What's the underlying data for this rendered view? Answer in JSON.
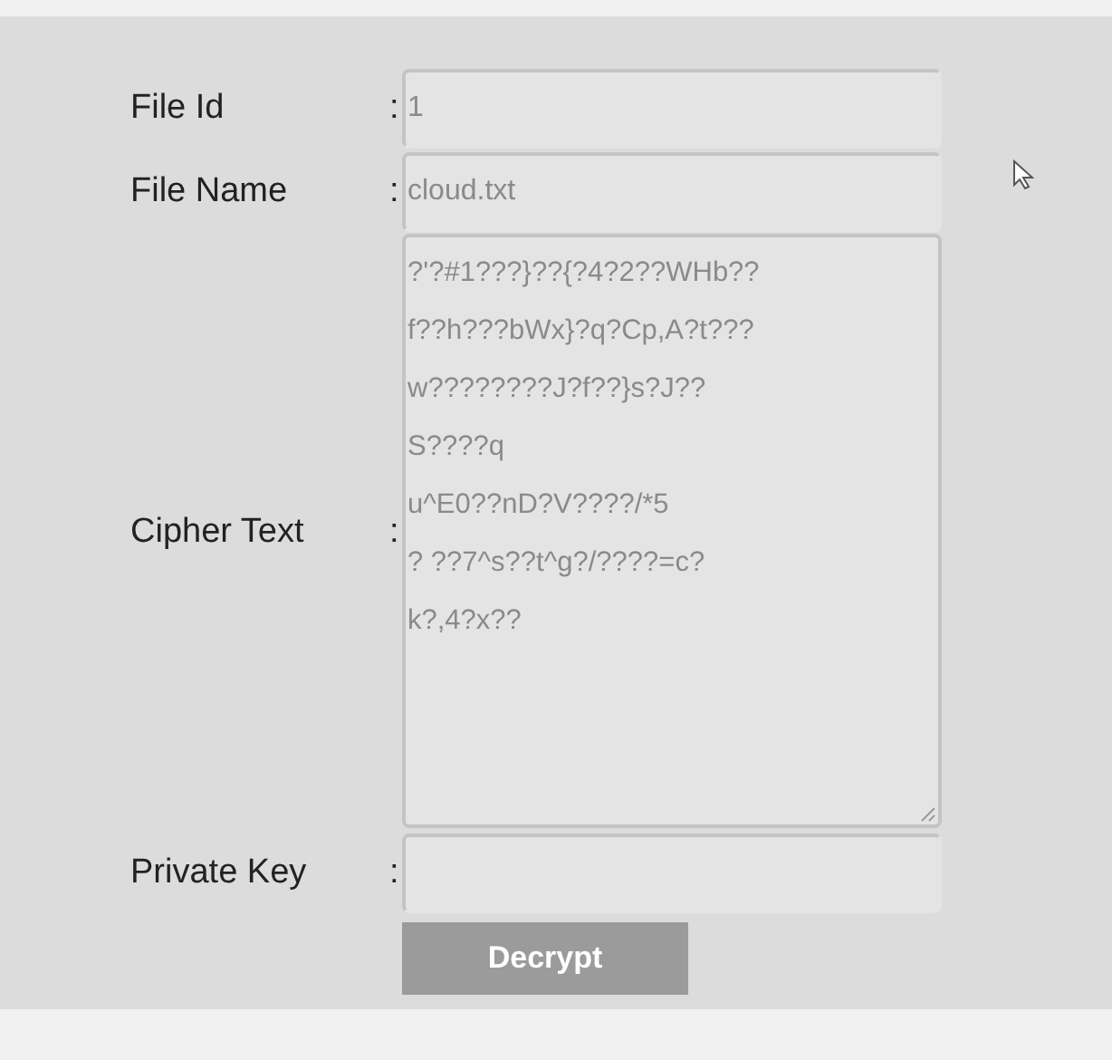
{
  "fields": [
    {
      "kind": "input",
      "label": "File Id",
      "colon": ":",
      "value": "1"
    },
    {
      "kind": "input",
      "label": "File Name",
      "colon": ":",
      "value": "cloud.txt"
    },
    {
      "kind": "textarea",
      "label": "Cipher Text",
      "colon": ":",
      "lines": [
        "?'?#1???}??{?4?2??WHb??",
        "f??h???bWx}?q?Cp,A?t???",
        "w????????J?f??}s?J??",
        "S????q",
        "u^E0??nD?V????/*5",
        "? ??7^s??t^g?/????=c?",
        "k?,4?x??"
      ]
    },
    {
      "kind": "input",
      "label": "Private Key",
      "colon": ":"
    }
  ],
  "button": {
    "label": "Decrypt"
  }
}
